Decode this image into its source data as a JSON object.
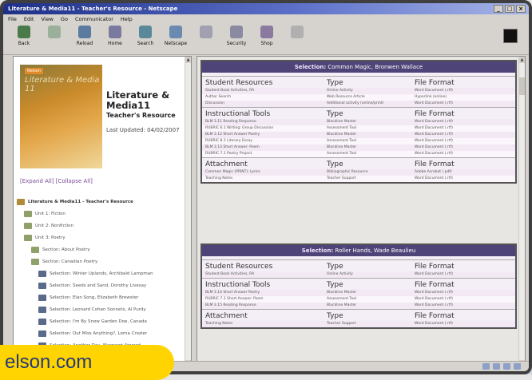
{
  "window": {
    "title": "Literature & Media11 - Teacher's Resource - Netscape",
    "buttons": [
      "_",
      "□",
      "×"
    ]
  },
  "menu": [
    "File",
    "Edit",
    "View",
    "Go",
    "Communicator",
    "Help"
  ],
  "toolbar": [
    {
      "label": "Back",
      "icon": "back-arrow-icon",
      "color": "#4a7a4a"
    },
    {
      "label": "",
      "icon": "forward-arrow-icon",
      "color": "#9ab09a"
    },
    {
      "label": "Reload",
      "icon": "reload-icon",
      "color": "#5a7aa0"
    },
    {
      "label": "Home",
      "icon": "home-icon",
      "color": "#7a7aa0"
    },
    {
      "label": "Search",
      "icon": "search-icon",
      "color": "#5a8a9a"
    },
    {
      "label": "Netscape",
      "icon": "netscape-icon",
      "color": "#6a8ab0"
    },
    {
      "label": "",
      "icon": "print-icon",
      "color": "#a0a0b0"
    },
    {
      "label": "Security",
      "icon": "security-icon",
      "color": "#8a8aa0"
    },
    {
      "label": "Shop",
      "icon": "shop-icon",
      "color": "#8a7aa0"
    },
    {
      "label": "",
      "icon": "stop-icon",
      "color": "#b0b0b0"
    }
  ],
  "book": {
    "cover_tab": "Nelson",
    "cover_title": "Literature & Media 11",
    "title_line1": "Literature &",
    "title_line2": "Media11",
    "subtitle": "Teacher's Resource",
    "updated": "Last Updated: 04/02/2007"
  },
  "tree_controls": "[Expand All]  [Collapse All]",
  "tree": [
    {
      "label": "Literature & Media11 - Teacher's Resource",
      "level": 0,
      "kind": "book"
    },
    {
      "label": "Unit 1: Fiction",
      "level": 1,
      "kind": "folder"
    },
    {
      "label": "Unit 2: Nonfiction",
      "level": 1,
      "kind": "folder"
    },
    {
      "label": "Unit 3: Poetry",
      "level": 1,
      "kind": "folder"
    },
    {
      "label": "Section: About Poetry",
      "level": 2,
      "kind": "folder"
    },
    {
      "label": "Section: Canadian Poetry",
      "level": 2,
      "kind": "folder"
    },
    {
      "label": "Selection: Winter Uplands, Archibald Lampman",
      "level": 3,
      "kind": "doc"
    },
    {
      "label": "Selection: Seeds and Sand, Dorothy Livesay",
      "level": 3,
      "kind": "doc"
    },
    {
      "label": "Selection: Elan Song, Elizabeth Brewster",
      "level": 3,
      "kind": "doc"
    },
    {
      "label": "Selection: Leonard Cohen Sonnets, Al Purdy",
      "level": 3,
      "kind": "doc"
    },
    {
      "label": "Selection: I'm By Snow Garden Doe, Canada",
      "level": 3,
      "kind": "doc"
    },
    {
      "label": "Selection: Out Miss Anything?, Lorna Crozier",
      "level": 3,
      "kind": "doc"
    },
    {
      "label": "Selection: Another Day, Margaret Atwood",
      "level": 3,
      "kind": "doc"
    },
    {
      "label": "Selection: Common Magic, Bronwen Wallace",
      "level": 3,
      "kind": "doc"
    },
    {
      "label": "Selection: Roller Hands, Wade Beaulieu",
      "level": 3,
      "kind": "doc"
    }
  ],
  "panels": [
    {
      "heading_prefix": "Selection:",
      "heading_name": "Common Magic, Bronwen Wallace",
      "sections": [
        {
          "h1": "Student Resources",
          "h2": "Type",
          "h3": "File Format",
          "rows": [
            [
              "Student Book Activities, RA",
              "Online Activity",
              "Word Document (.rtf)"
            ],
            [
              "Author Search",
              "Web Resource Article",
              "Hyperlink (online)"
            ],
            [
              "Discussion",
              "Additional activity (online/print)",
              "Word Document (.rtf)"
            ]
          ]
        },
        {
          "h1": "Instructional Tools",
          "h2": "Type",
          "h3": "File Format",
          "rows": [
            [
              "BLM 3.11 Reading Response",
              "Blackline Master",
              "Word Document (.rtf)"
            ],
            [
              "RUBRIC 6.1 Writing: Group Discussion",
              "Assessment Tool",
              "Word Document (.rtf)"
            ],
            [
              "BLM 3.12 Short Answer Poetry",
              "Blackline Master",
              "Word Document (.rtf)"
            ],
            [
              "RUBRIC 8.1 Literary Essay",
              "Assessment Tool",
              "Word Document (.rtf)"
            ],
            [
              "BLM 3.13 Short Answer: Poem",
              "Blackline Master",
              "Word Document (.rtf)"
            ],
            [
              "RUBRIC 7.1 Poetry Project",
              "Assessment Tool",
              "Word Document (.rtf)"
            ]
          ]
        },
        {
          "h1": "Attachment",
          "h2": "Type",
          "h3": "File Format",
          "rows": [
            [
              "Common Magic (PRINT): Lyrics",
              "Bibliographic Resource",
              "Adobe Acrobat (.pdf)"
            ],
            [
              "Teaching Notes",
              "Teacher Support",
              "Word Document (.rtf)"
            ]
          ]
        }
      ]
    },
    {
      "heading_prefix": "Selection:",
      "heading_name": "Roller Hands, Wade Beaulieu",
      "sections": [
        {
          "h1": "Student Resources",
          "h2": "Type",
          "h3": "File Format",
          "rows": [
            [
              "Student Book Activities, RA",
              "Online Activity",
              "Word Document (.rtf)"
            ]
          ]
        },
        {
          "h1": "Instructional Tools",
          "h2": "Type",
          "h3": "File Format",
          "rows": [
            [
              "BLM 3.14 Short Answer Poetry",
              "Blackline Master",
              "Word Document (.rtf)"
            ],
            [
              "RUBRIC 7.1 Short Answer: Poem",
              "Assessment Tool",
              "Word Document (.rtf)"
            ],
            [
              "BLM 3.15 Reading Response",
              "Blackline Master",
              "Word Document (.rtf)"
            ]
          ]
        },
        {
          "h1": "Attachment",
          "h2": "Type",
          "h3": "File Format",
          "rows": [
            [
              "Teaching Notes",
              "Teacher Support",
              "Word Document (.rtf)"
            ]
          ]
        }
      ]
    }
  ],
  "watermark": "elson.com",
  "colors": {
    "panel_header": "#4e4478",
    "row_tint": "#f3e9f4",
    "link": "#7a4a9a",
    "watermark_bg": "#ffd400",
    "watermark_text": "#243a78"
  }
}
